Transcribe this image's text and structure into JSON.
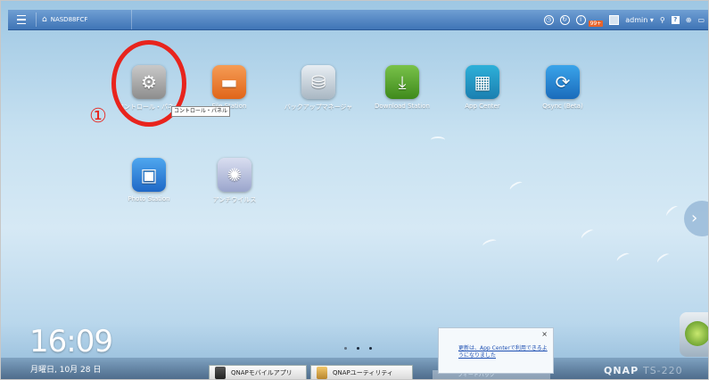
{
  "topbar": {
    "nas_name": "NASD88FCF",
    "notification_count": "99+",
    "user": "admin",
    "user_caret": "▾",
    "search_glyph": "⚲",
    "help_glyph": "?",
    "globe_glyph": "⊕",
    "screen_glyph": "▭"
  },
  "apps": [
    {
      "label": "コントロール・パネル",
      "icon": "gear-icon"
    },
    {
      "label": "File Station",
      "icon": "folder-icon"
    },
    {
      "label": "バックアップマネージャ",
      "icon": "backup-icon"
    },
    {
      "label": "Download Station",
      "icon": "download-icon"
    },
    {
      "label": "App Center",
      "icon": "grid-icon"
    },
    {
      "label": "Qsync (Beta)",
      "icon": "sync-icon"
    },
    {
      "label": "Photo Station",
      "icon": "photo-icon"
    },
    {
      "label": "アンチウイルス",
      "icon": "antivirus-icon"
    }
  ],
  "annotation": {
    "number": "①",
    "tooltip": "コントロール・パネル",
    "color": "#e8241d"
  },
  "clock": {
    "time": "16:09",
    "date": "月曜日, 10月 28 日"
  },
  "taskbar": {
    "items": [
      {
        "label": "QNAPモバイルアプリ"
      },
      {
        "label": "QNAPユーティリティ"
      }
    ],
    "feedback": "フィードバック"
  },
  "notification": {
    "message": "更新は、App Centerで利用できるようになりました",
    "close": "×"
  },
  "logo": {
    "brand": "QNAP",
    "model": "TS-220"
  },
  "colors": {
    "topbar": "#3f74b6",
    "accent_red": "#e8241d"
  }
}
